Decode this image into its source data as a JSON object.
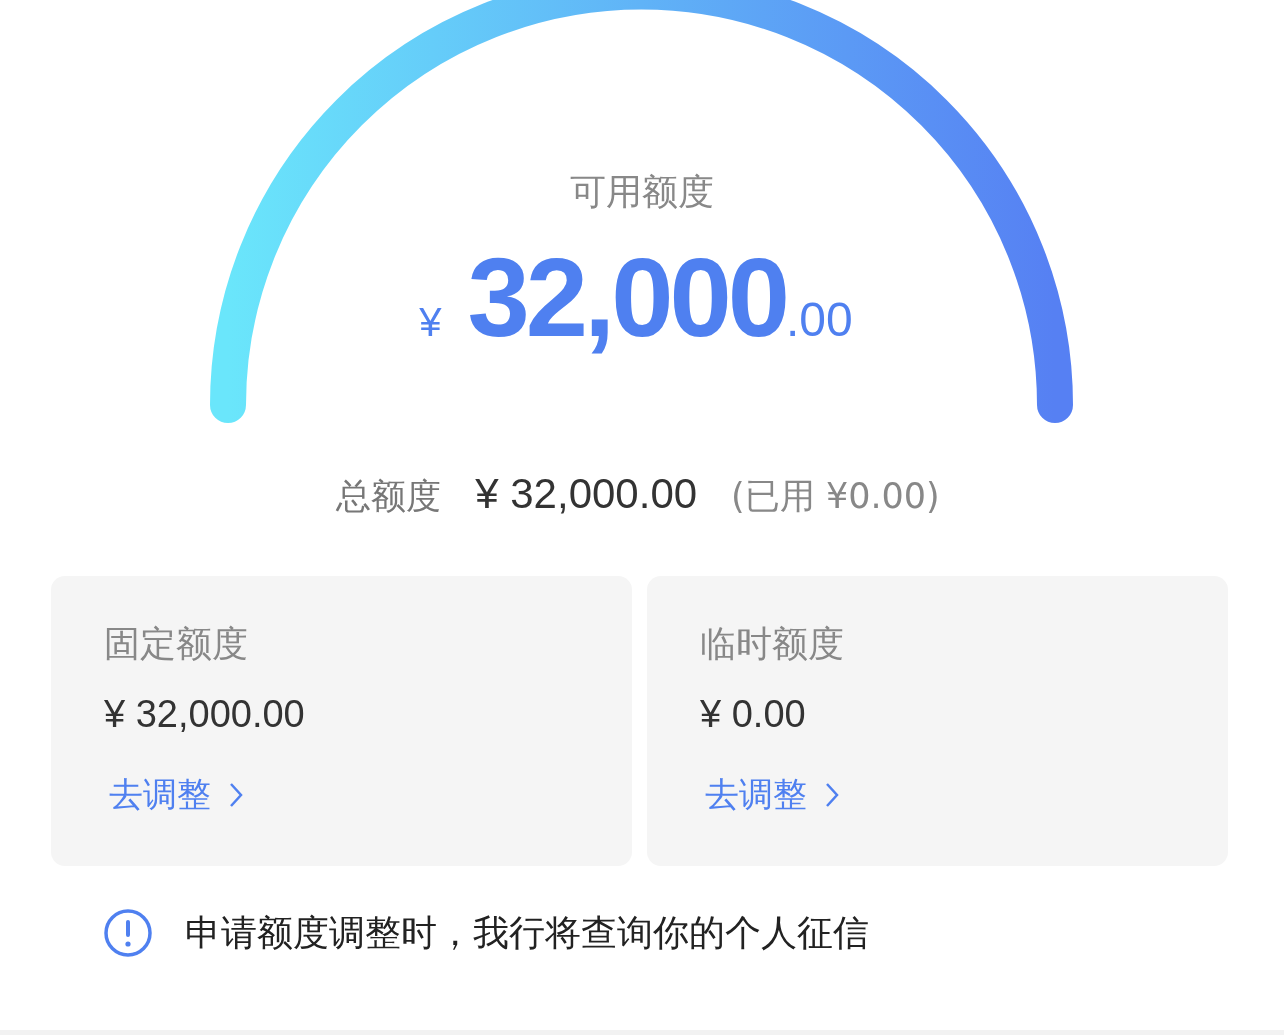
{
  "gauge": {
    "label": "可用额度",
    "currency": "¥",
    "amount": "32,000",
    "decimals": ".00"
  },
  "total": {
    "label": "总额度",
    "amount": "¥ 32,000.00",
    "used": "(已用 ¥0.00)"
  },
  "cards": [
    {
      "title": "固定额度",
      "amount": "¥ 32,000.00",
      "link": "去调整"
    },
    {
      "title": "临时额度",
      "amount": "¥ 0.00",
      "link": "去调整"
    }
  ],
  "notice": {
    "text": "申请额度调整时，我行将查询你的个人征信"
  }
}
